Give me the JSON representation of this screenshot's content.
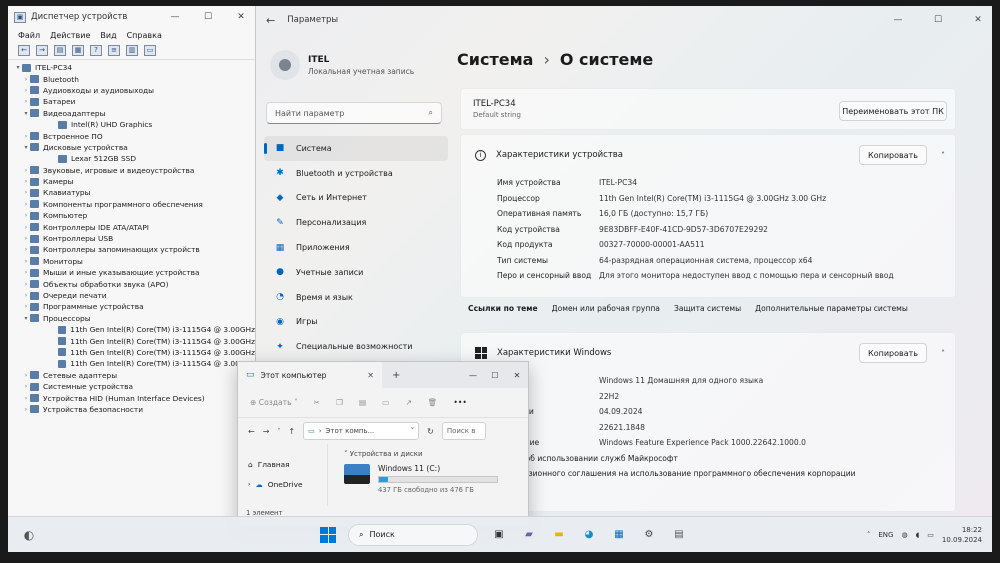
{
  "device_manager": {
    "title": "Диспетчер устройств",
    "menu": [
      "Файл",
      "Действие",
      "Вид",
      "Справка"
    ],
    "tree": [
      {
        "label": "ITEL-PC34",
        "level": 0,
        "arrow": "▾"
      },
      {
        "label": "Bluetooth",
        "level": 1,
        "arrow": "›"
      },
      {
        "label": "Аудиовходы и аудиовыходы",
        "level": 1,
        "arrow": "›"
      },
      {
        "label": "Батареи",
        "level": 1,
        "arrow": "›"
      },
      {
        "label": "Видеоадаптеры",
        "level": 1,
        "arrow": "▾"
      },
      {
        "label": "Intel(R) UHD Graphics",
        "level": 2,
        "arrow": ""
      },
      {
        "label": "Встроенное ПО",
        "level": 1,
        "arrow": "›"
      },
      {
        "label": "Дисковые устройства",
        "level": 1,
        "arrow": "▾"
      },
      {
        "label": "Lexar 512GB SSD",
        "level": 2,
        "arrow": ""
      },
      {
        "label": "Звуковые, игровые и видеоустройства",
        "level": 1,
        "arrow": "›"
      },
      {
        "label": "Камеры",
        "level": 1,
        "arrow": "›"
      },
      {
        "label": "Клавиатуры",
        "level": 1,
        "arrow": "›"
      },
      {
        "label": "Компоненты программного обеспечения",
        "level": 1,
        "arrow": "›"
      },
      {
        "label": "Компьютер",
        "level": 1,
        "arrow": "›"
      },
      {
        "label": "Контроллеры IDE ATA/ATAPI",
        "level": 1,
        "arrow": "›"
      },
      {
        "label": "Контроллеры USB",
        "level": 1,
        "arrow": "›"
      },
      {
        "label": "Контроллеры запоминающих устройств",
        "level": 1,
        "arrow": "›"
      },
      {
        "label": "Мониторы",
        "level": 1,
        "arrow": "›"
      },
      {
        "label": "Мыши и иные указывающие устройства",
        "level": 1,
        "arrow": "›"
      },
      {
        "label": "Объекты обработки звука (APO)",
        "level": 1,
        "arrow": "›"
      },
      {
        "label": "Очереди печати",
        "level": 1,
        "arrow": "›"
      },
      {
        "label": "Программные устройства",
        "level": 1,
        "arrow": "›"
      },
      {
        "label": "Процессоры",
        "level": 1,
        "arrow": "▾"
      },
      {
        "label": "11th Gen Intel(R) Core(TM) i3-1115G4 @ 3.00GHz",
        "level": 2,
        "arrow": ""
      },
      {
        "label": "11th Gen Intel(R) Core(TM) i3-1115G4 @ 3.00GHz",
        "level": 2,
        "arrow": ""
      },
      {
        "label": "11th Gen Intel(R) Core(TM) i3-1115G4 @ 3.00GHz",
        "level": 2,
        "arrow": ""
      },
      {
        "label": "11th Gen Intel(R) Core(TM) i3-1115G4 @ 3.00GHz",
        "level": 2,
        "arrow": ""
      },
      {
        "label": "Сетевые адаптеры",
        "level": 1,
        "arrow": "›"
      },
      {
        "label": "Системные устройства",
        "level": 1,
        "arrow": "›"
      },
      {
        "label": "Устройства HID (Human Interface Devices)",
        "level": 1,
        "arrow": "›"
      },
      {
        "label": "Устройства безопасности",
        "level": 1,
        "arrow": "›"
      }
    ]
  },
  "settings": {
    "title": "Параметры",
    "user_name": "ITEL",
    "user_sub": "Локальная учетная запись",
    "search_placeholder": "Найти параметр",
    "nav": [
      {
        "label": "Система",
        "icon": "■",
        "active": true
      },
      {
        "label": "Bluetooth и устройства",
        "icon": "✱"
      },
      {
        "label": "Сеть и Интернет",
        "icon": "◆"
      },
      {
        "label": "Персонализация",
        "icon": "✎"
      },
      {
        "label": "Приложения",
        "icon": "▦"
      },
      {
        "label": "Учетные записи",
        "icon": "●"
      },
      {
        "label": "Время и язык",
        "icon": "◔"
      },
      {
        "label": "Игры",
        "icon": "◉"
      },
      {
        "label": "Специальные возможности",
        "icon": "✦"
      }
    ],
    "breadcrumb_parent": "Система",
    "breadcrumb_sep": "›",
    "breadcrumb_current": "О системе",
    "pc_name": "ITEL-PC34",
    "pc_sub": "Default string",
    "rename_label": "Переименовать этот ПК",
    "spec_title": "Характеристики устройства",
    "copy_label": "Копировать",
    "specs": [
      {
        "k": "Имя устройства",
        "v": "ITEL-PC34"
      },
      {
        "k": "Процессор",
        "v": "11th Gen Intel(R) Core(TM) i3-1115G4 @ 3.00GHz   3.00 GHz"
      },
      {
        "k": "Оперативная память",
        "v": "16,0 ГБ (доступно: 15,7 ГБ)"
      },
      {
        "k": "Код устройства",
        "v": "9E83DBFF-E40F-41CD-9D57-3D6707E29292"
      },
      {
        "k": "Код продукта",
        "v": "00327-70000-00001-AA511"
      },
      {
        "k": "Тип системы",
        "v": "64-разрядная операционная система, процессор x64"
      },
      {
        "k": "Перо и сенсорный ввод",
        "v": "Для этого монитора недоступен ввод с помощью пера и сенсорный ввод"
      }
    ],
    "links_label": "Ссылки по теме",
    "links": [
      "Домен или рабочая группа",
      "Защита системы",
      "Дополнительные параметры системы"
    ],
    "win_title": "Характеристики Windows",
    "win_specs": [
      {
        "k": "к",
        "v": "Windows 11 Домашняя для одного языка"
      },
      {
        "k": "",
        "v": "22H2"
      },
      {
        "k": "становки",
        "v": "04.09.2024"
      },
      {
        "k": "а ОС",
        "v": "22621.1848"
      },
      {
        "k": "одействие",
        "v": "Windows Feature Experience Pack 1000.22642.1000.0"
      }
    ],
    "win_lines": [
      "шение об использовании служб Майкрософт",
      "я лицензионного соглашения на использование программного обеспечения корпорации",
      "софт"
    ]
  },
  "explorer": {
    "tab_title": "Этот компьютер",
    "create_label": "Создать",
    "address": "Этот компь...",
    "search_placeholder": "Поиск в",
    "sidebar": [
      "Главная",
      "OneDrive"
    ],
    "group_label": "Устройства и диски",
    "drive_name": "Windows 11 (C:)",
    "drive_free": "437 ГБ свободно из 476 ГБ",
    "drive_used_fraction": 0.08,
    "status": "1 элемент"
  },
  "taskbar": {
    "search_label": "Поиск",
    "lang": "ENG",
    "time": "18:22",
    "date": "10.09.2024"
  }
}
